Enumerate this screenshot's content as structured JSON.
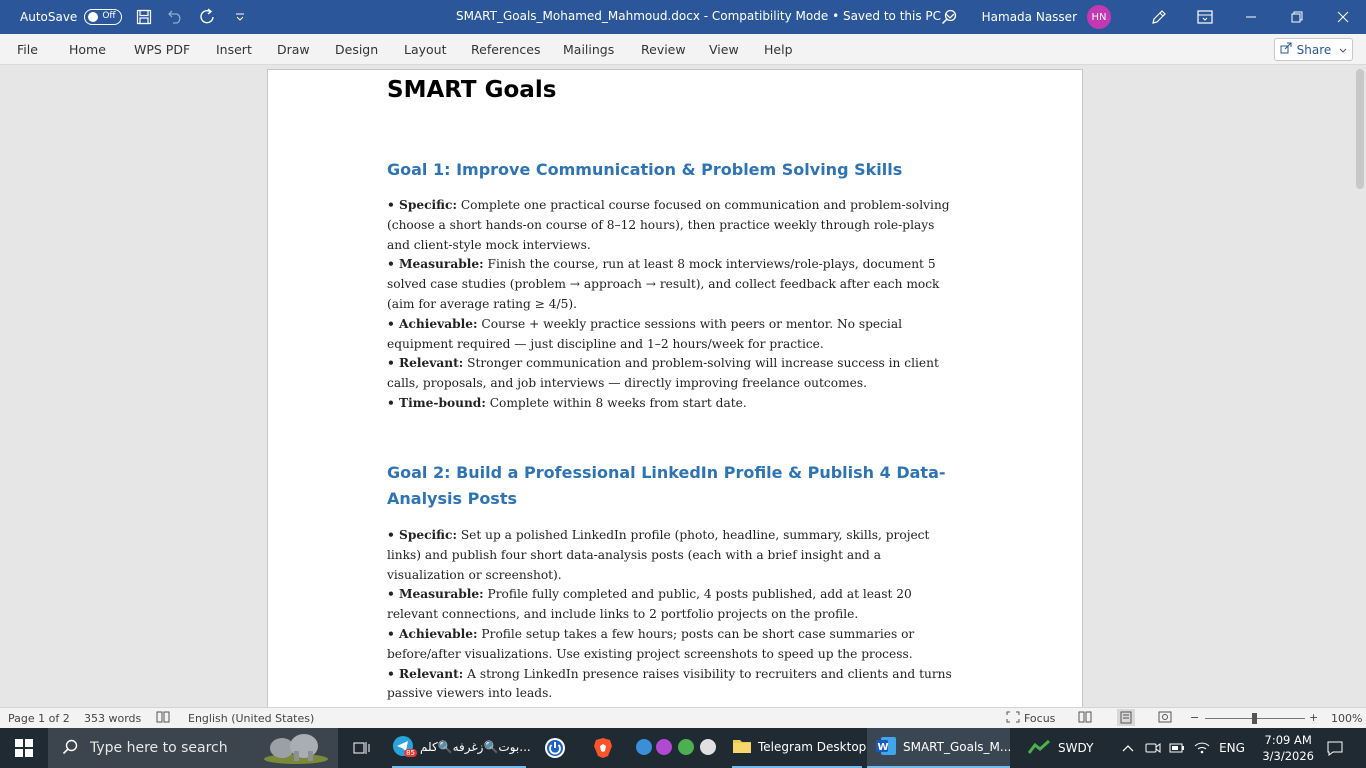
{
  "titlebar": {
    "autosave_label": "AutoSave",
    "autosave_state": "Off",
    "doc_title": "SMART_Goals_Mohamed_Mahmoud.docx  -  Compatibility Mode • Saved to this PC",
    "user_name": "Hamada Nasser",
    "user_initials": "HN"
  },
  "ribbon": {
    "tabs": [
      "File",
      "Home",
      "WPS PDF",
      "Insert",
      "Draw",
      "Design",
      "Layout",
      "References",
      "Mailings",
      "Review",
      "View",
      "Help"
    ],
    "share_label": "Share"
  },
  "document": {
    "title": "SMART Goals",
    "goal1": {
      "heading": "Goal 1: Improve Communication & Problem Solving Skills",
      "items": [
        {
          "label": "• Specific:",
          "text": " Complete one practical course focused on communication and problem-solving (choose a short hands-on course of 8–12 hours), then practice weekly through role-plays and client-style mock interviews."
        },
        {
          "label": "• Measurable:",
          "text": " Finish the course, run at least 8 mock interviews/role-plays, document 5 solved case studies (problem → approach → result), and collect feedback after each mock (aim for average rating ≥ 4/5)."
        },
        {
          "label": "• Achievable:",
          "text": " Course + weekly practice sessions with peers or mentor. No special equipment required — just discipline and 1–2 hours/week for practice."
        },
        {
          "label": "• Relevant:",
          "text": " Stronger communication and problem-solving will increase success in client calls, proposals, and job interviews — directly improving freelance outcomes."
        },
        {
          "label": "• Time-bound:",
          "text": " Complete within 8 weeks from start date."
        }
      ]
    },
    "goal2": {
      "heading": "Goal 2: Build a Professional LinkedIn Profile & Publish 4 Data-Analysis Posts",
      "items": [
        {
          "label": "• Specific:",
          "text": " Set up a polished LinkedIn profile (photo, headline, summary, skills, project links) and publish four short data-analysis posts (each with a brief insight and a visualization or screenshot)."
        },
        {
          "label": "• Measurable:",
          "text": " Profile fully completed and public, 4 posts published, add at least 20 relevant connections, and include links to 2 portfolio projects on the profile."
        },
        {
          "label": "• Achievable:",
          "text": " Profile setup takes a few hours; posts can be short case summaries or before/after visualizations. Use existing project screenshots to speed up the process."
        },
        {
          "label": "• Relevant:",
          "text": " A strong LinkedIn presence raises visibility to recruiters and clients and turns passive viewers into leads."
        }
      ]
    }
  },
  "statusbar": {
    "page": "Page 1 of 2",
    "words": "353 words",
    "language": "English (United States)",
    "focus": "Focus",
    "zoom": "100%"
  },
  "taskbar": {
    "search_placeholder": "Type here to search",
    "telegram_chat": "بوت🔍زغرفه🔍كلم...",
    "telegram_desktop": "Telegram Desktop",
    "word_app": "SMART_Goals_M...",
    "weather": "SWDY",
    "lang": "ENG",
    "time": "7:09 AM",
    "date": "3/3/2026",
    "badge": "85"
  }
}
